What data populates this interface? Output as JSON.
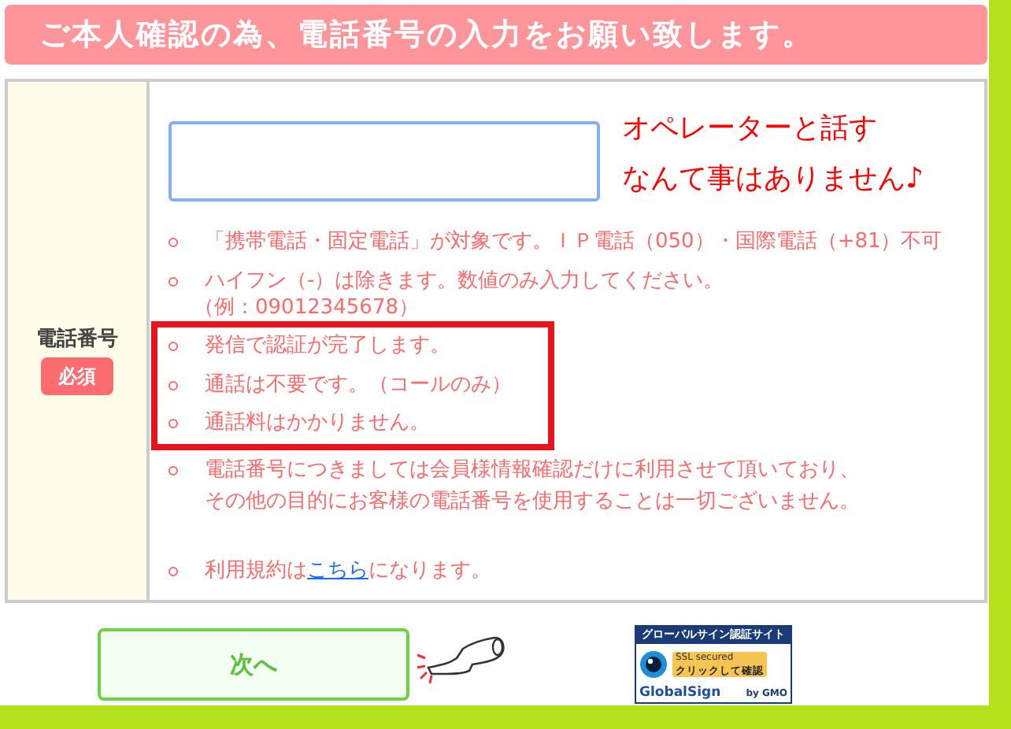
{
  "header": {
    "title": "ご本人確認の為、電話番号の入力をお願い致します。"
  },
  "form": {
    "label": "電話番号",
    "required_badge": "必須",
    "phone_input": {
      "focused": true
    },
    "callout": [
      "オペレーターと話す",
      "なんて事はありません♪"
    ],
    "notes": [
      {
        "kind": "plain",
        "lines": [
          "「携帯電話・固定電話」が対象です。ＩＰ電話（050）・国際電話（+81）不可"
        ],
        "highlighted": false
      },
      {
        "kind": "plain",
        "lines": [
          "ハイフン（-）は除きます。数値のみ入力してください。",
          "（例：09012345678）"
        ],
        "highlighted": false
      },
      {
        "kind": "plain",
        "lines": [
          "発信で認証が完了します。"
        ],
        "highlighted": true
      },
      {
        "kind": "plain",
        "lines": [
          "通話は不要です。（コールのみ）"
        ],
        "highlighted": true
      },
      {
        "kind": "plain",
        "lines": [
          "通話料はかかりません。"
        ],
        "highlighted": true
      },
      {
        "kind": "plain",
        "lines": [
          "電話番号につきましては会員様情報確認だけに利用させて頂いており、",
          "その他の目的にお客様の電話番号を使用することは一切ございません。"
        ],
        "highlighted": false
      },
      {
        "kind": "link",
        "text_before": "利用規約は",
        "link": "こちら",
        "text_after": "になります。",
        "highlighted": false
      }
    ]
  },
  "next_button": {
    "label": "次へ"
  },
  "seal": {
    "top": "グローバルサイン認証サイト",
    "ssl": "SSL secured",
    "check": "クリックして確認",
    "brand": "GlobalSign",
    "by": "by GMO"
  }
}
